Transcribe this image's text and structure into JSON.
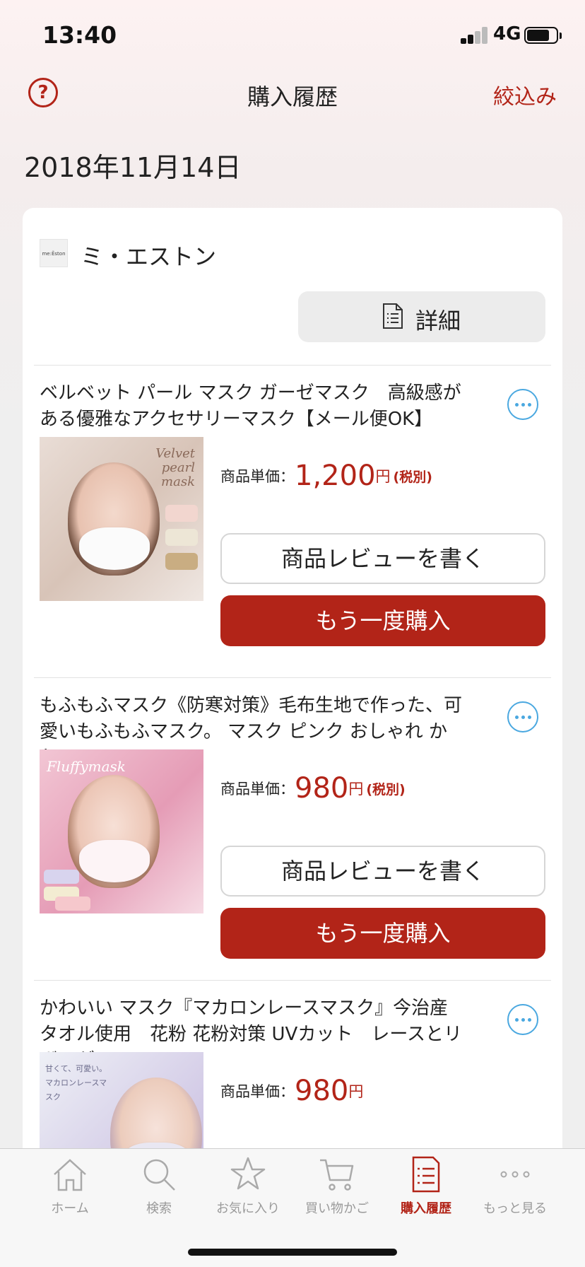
{
  "status": {
    "time": "13:40",
    "network": "4G"
  },
  "header": {
    "help_icon": "?",
    "title": "購入履歴",
    "filter_label": "絞込み"
  },
  "date": "2018年11月14日",
  "shop": {
    "logo_text": "me:Ěston",
    "name": "ミ・エストン",
    "detail_label": "詳細"
  },
  "items": [
    {
      "title": "ベルベット パール マスク ガーゼマスク　高級感がある優雅なアクセサリーマスク【メール便OK】",
      "image_caption": "Velvet pearl mask",
      "price_label": "商品単価：",
      "price": "1,200",
      "currency": "円",
      "tax_note": "(税別)",
      "review_label": "商品レビューを書く",
      "rebuy_label": "もう一度購入"
    },
    {
      "title": "もふもふマスク《防寒対策》毛布生地で作った、可愛いもふもふマスク。 マスク ピンク おしゃれ かわい…",
      "image_caption": "Fluffymask",
      "price_label": "商品単価：",
      "price": "980",
      "currency": "円",
      "tax_note": "(税別)",
      "review_label": "商品レビューを書く",
      "rebuy_label": "もう一度購入"
    },
    {
      "title": "かわいい マスク『マカロンレースマスク』今治産タオル使用　花粉 花粉対策 UVカット　レースとリボンが…",
      "image_caption": "甘くて、可愛い。マカロンレースマスク",
      "price_label": "商品単価：",
      "price": "980",
      "currency": "円"
    }
  ],
  "tabs": [
    {
      "label": "ホーム",
      "icon": "home-icon"
    },
    {
      "label": "検索",
      "icon": "search-icon"
    },
    {
      "label": "お気に入り",
      "icon": "star-icon"
    },
    {
      "label": "買い物かご",
      "icon": "cart-icon"
    },
    {
      "label": "購入履歴",
      "icon": "receipt-icon",
      "active": true
    },
    {
      "label": "もっと見る",
      "icon": "more-icon"
    }
  ],
  "colors": {
    "accent": "#b22418",
    "link_blue": "#4aa8e0",
    "inactive": "#9a9a9a"
  }
}
